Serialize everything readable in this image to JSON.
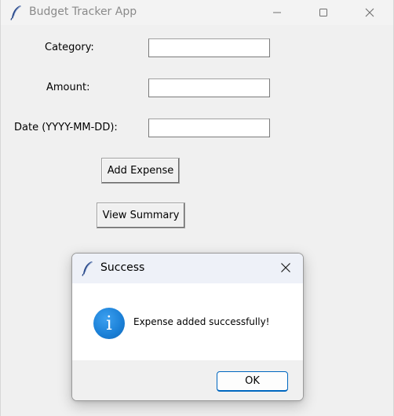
{
  "app": {
    "title": "Budget Tracker App",
    "icon": "feather-icon"
  },
  "window_controls": {
    "minimize_icon": "minimize-icon",
    "maximize_icon": "maximize-icon",
    "close_icon": "close-icon"
  },
  "form": {
    "category_label": "Category:",
    "category_value": "",
    "amount_label": "Amount:",
    "amount_value": "",
    "date_label": "Date (YYYY-MM-DD):",
    "date_value": ""
  },
  "buttons": {
    "add_expense": "Add Expense",
    "view_summary": "View Summary"
  },
  "dialog": {
    "title": "Success",
    "message": "Expense added successfully!",
    "ok_label": "OK",
    "info_glyph": "i",
    "icon": "info-icon",
    "accent_color": "#0067c0"
  }
}
